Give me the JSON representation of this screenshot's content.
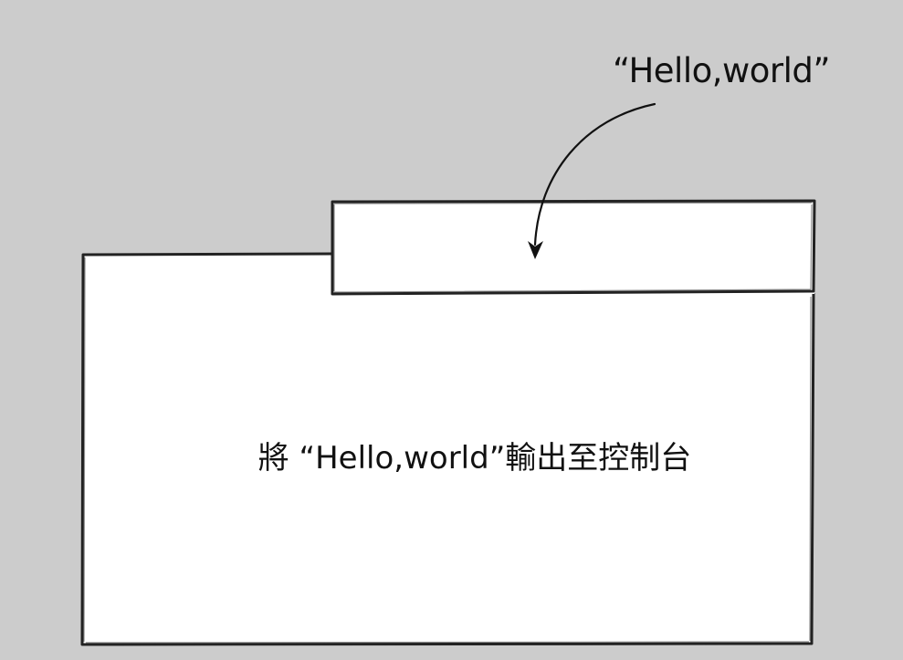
{
  "diagram": {
    "input_label": "“Hello,world”",
    "function_body_label": "將 “Hello,world”輸出至控制台"
  },
  "colors": {
    "background": "#cccccc",
    "box_fill": "#ffffff",
    "stroke": "#222222"
  }
}
